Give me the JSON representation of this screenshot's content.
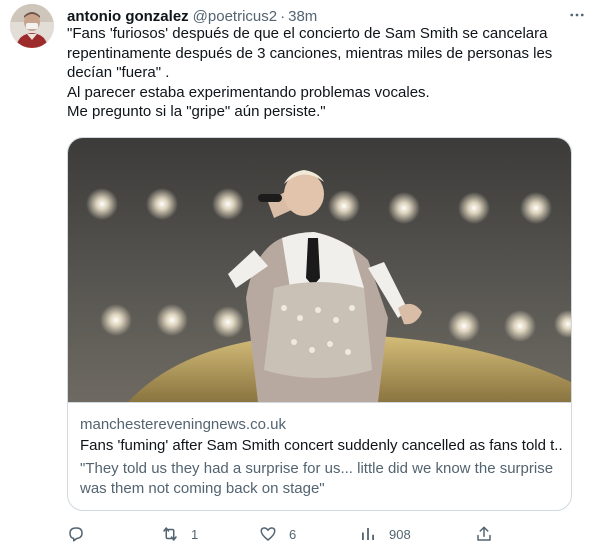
{
  "tweet": {
    "author": {
      "display_name": "antonio gonzalez",
      "handle": "@poetricus2",
      "separator": "·",
      "time": "38m"
    },
    "text_lines": [
      "\"Fans 'furiosos' después de que el concierto de Sam Smith se cancelara",
      "repentinamente después de 3 canciones, mientras miles de personas les",
      "decían \"fuera\" .",
      "Al parecer estaba experimentando problemas vocales.",
      "Me pregunto si la \"gripe\" aún persiste.\""
    ],
    "card": {
      "domain": "manchestereveningnews.co.uk",
      "title": "Fans 'fuming' after Sam Smith concert suddenly cancelled as fans told t...",
      "description": "\"They told us they had a surprise for us... little did we know the surprise was them not coming back on stage\""
    },
    "actions": {
      "reply": {
        "icon": "reply-icon",
        "count": ""
      },
      "retweet": {
        "icon": "retweet-icon",
        "count": "1"
      },
      "like": {
        "icon": "heart-icon",
        "count": "6"
      },
      "views": {
        "icon": "views-icon",
        "count": "908"
      },
      "share": {
        "icon": "share-icon",
        "count": ""
      }
    },
    "colors": {
      "text_primary": "#0f1419",
      "text_secondary": "#536471",
      "border": "#cfd9de",
      "background": "#ffffff"
    }
  }
}
